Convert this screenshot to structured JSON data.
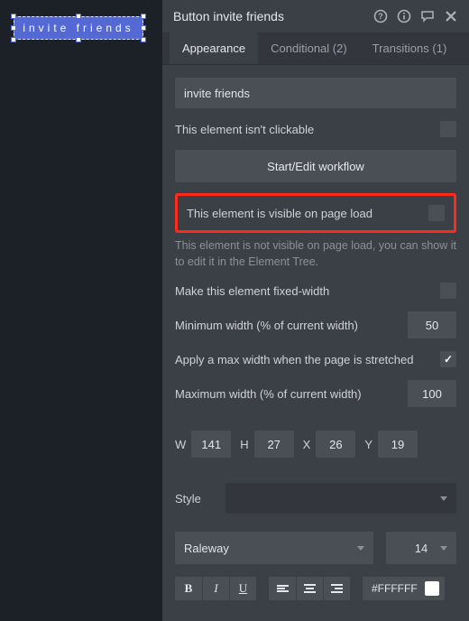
{
  "canvas_button": {
    "text": "invite friends"
  },
  "panel": {
    "title": "Button invite friends",
    "tabs": {
      "appearance": "Appearance",
      "conditional": "Conditional (2)",
      "transitions": "Transitions (1)"
    },
    "name_value": "invite friends",
    "clickable_label": "This element isn't clickable",
    "workflow_btn": "Start/Edit workflow",
    "visible_label": "This element is visible on page load",
    "visible_help": "This element is not visible on page load, you can show it to edit it in the Element Tree.",
    "fixed_width_label": "Make this element fixed-width",
    "min_width_label": "Minimum width (% of current width)",
    "min_width_value": "50",
    "max_apply_label": "Apply a max width when the page is stretched",
    "max_width_label": "Maximum width (% of current width)",
    "max_width_value": "100",
    "geom": {
      "w_label": "W",
      "w": "141",
      "h_label": "H",
      "h": "27",
      "x_label": "X",
      "x": "26",
      "y_label": "Y",
      "y": "19"
    },
    "style_label": "Style",
    "style_value": "",
    "font_family": "Raleway",
    "font_size": "14",
    "fmt": {
      "bold": "B",
      "italic": "I",
      "underline": "U"
    },
    "color_hex": "#FFFFFF"
  }
}
